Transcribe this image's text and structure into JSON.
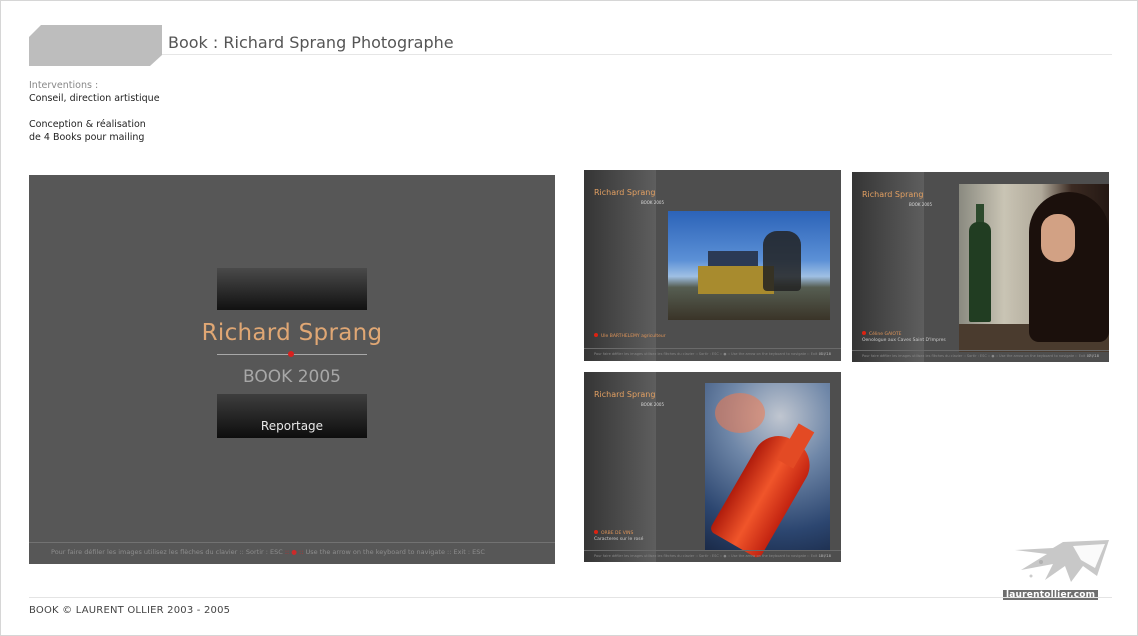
{
  "header": {
    "title": "Book : Richard Sprang Photographe"
  },
  "info": {
    "label": "Interventions :",
    "line1": "Conseil, direction artistique",
    "line2": "Conception & réalisation",
    "line3": "de 4 Books pour mailing"
  },
  "main_preview": {
    "name": "Richard Sprang",
    "subtitle": "BOOK 2005",
    "button": "Reportage",
    "footer_fr": "Pour faire défiler les images utilisez les flèches du clavier :: Sortir : ESC",
    "footer_sep": " :: ● :: ",
    "footer_en": "Use the arrow on the keyboard to navigate :: Exit : ESC"
  },
  "thumbnails": [
    {
      "name": "Richard Sprang",
      "sub": "BOOK 2005",
      "cap_title": "Ule BARTHELEMY agriculteur",
      "cap_text": "",
      "page": "01 / 18"
    },
    {
      "name": "Richard Sprang",
      "sub": "BOOK 2005",
      "cap_title": "Céline GAIOTE",
      "cap_text": "Oenologue aux Caves Saint D'Impres",
      "page": "07 / 18"
    },
    {
      "name": "Richard Sprang",
      "sub": "BOOK 2005",
      "cap_title": "ORBE DE VINS",
      "cap_text": "Caracteres sur le rosé",
      "page": "10 / 18"
    }
  ],
  "thumb_footer": "Pour faire défiler les images utilisez les flèches du clavier :: Sortir : ESC  ::  ●  ::  Use the arrow on the keyboard to navigate :: Exit : ESC",
  "footer": {
    "text": "BOOK © LAURENT OLLIER  2003 - 2005"
  },
  "logo": {
    "text": "laurentollier.com"
  },
  "colors": {
    "accent_orange": "#e0a774",
    "panel_gray": "#575757",
    "red_dot": "#d8201e"
  }
}
